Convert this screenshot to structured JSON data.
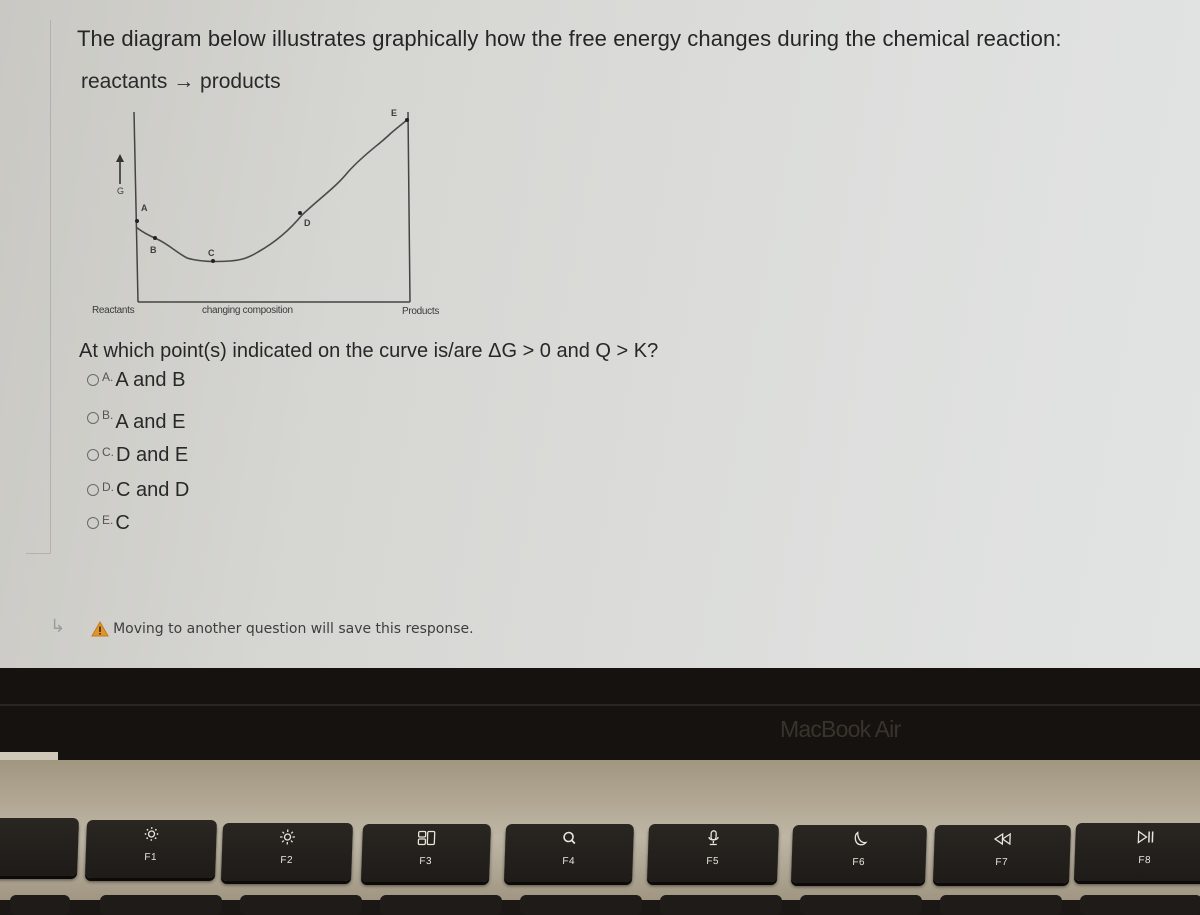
{
  "question": {
    "intro": "The diagram below illustrates graphically how the free energy changes during the chemical reaction:",
    "reaction": "reactants → products",
    "prompt": "At which point(s) indicated on the curve is/are ΔG > 0 and Q > K?"
  },
  "diagram": {
    "y_axis_label": "G",
    "x_left_label": "Reactants",
    "x_center_label": "changing composition",
    "x_right_label": "Products",
    "points": [
      {
        "label": "A"
      },
      {
        "label": "B"
      },
      {
        "label": "C"
      },
      {
        "label": "D"
      },
      {
        "label": "E"
      }
    ]
  },
  "options": [
    {
      "letter": "A.",
      "text": "A and B",
      "selected": false
    },
    {
      "letter": "B.",
      "text": "A and E",
      "selected": false
    },
    {
      "letter": "C.",
      "text": "D and E",
      "selected": false
    },
    {
      "letter": "D.",
      "text": "C and D",
      "selected": false
    },
    {
      "letter": "E.",
      "text": "C",
      "selected": false
    }
  ],
  "save_notice": {
    "text": "Moving to another question will save this response.",
    "icon": "warning-icon"
  },
  "laptop": {
    "brand": "MacBook Air",
    "function_keys": [
      {
        "label": "F1",
        "icon": "brightness-down-icon"
      },
      {
        "label": "F2",
        "icon": "brightness-up-icon"
      },
      {
        "label": "F3",
        "icon": "mission-control-icon"
      },
      {
        "label": "F4",
        "icon": "spotlight-search-icon"
      },
      {
        "label": "F5",
        "icon": "dictation-mic-icon"
      },
      {
        "label": "F6",
        "icon": "do-not-disturb-moon-icon"
      },
      {
        "label": "F7",
        "icon": "rewind-icon"
      },
      {
        "label": "F8",
        "icon": "play-pause-icon"
      }
    ]
  },
  "colors": {
    "warning": "#e0952a",
    "text": "#272727"
  }
}
